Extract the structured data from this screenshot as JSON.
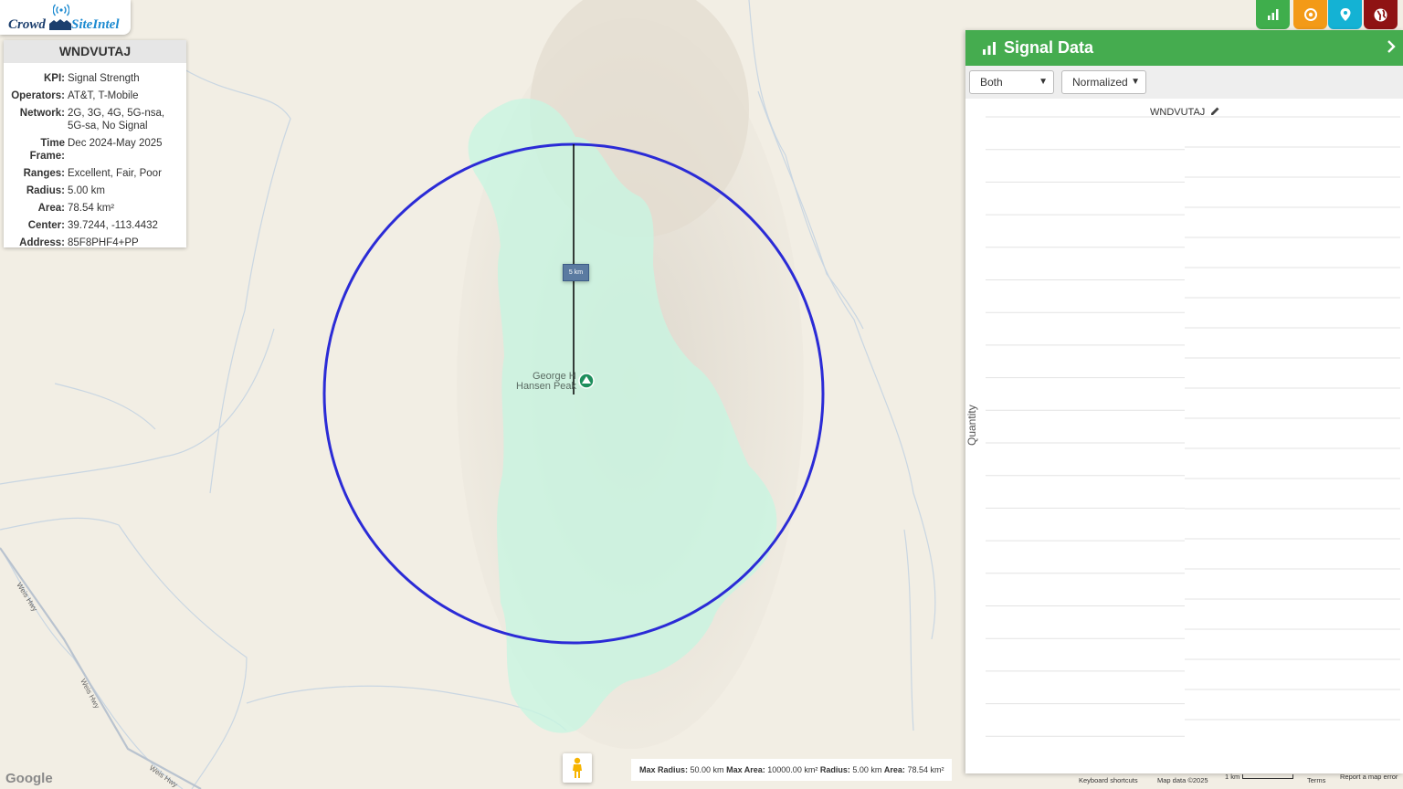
{
  "logo": {
    "word1": "Crowd",
    "word2": "SiteIntel"
  },
  "info": {
    "title": "WNDVUTAJ",
    "rows": [
      {
        "k": "KPI:",
        "v": "Signal Strength"
      },
      {
        "k": "Operators:",
        "v": "AT&T, T-Mobile"
      },
      {
        "k": "Network:",
        "v": "2G, 3G, 4G, 5G-nsa, 5G-sa, No Signal"
      },
      {
        "k": "Time Frame:",
        "v": "Dec 2024-May 2025"
      },
      {
        "k": "Ranges:",
        "v": "Excellent, Fair, Poor"
      },
      {
        "k": "Radius:",
        "v": "5.00 km"
      },
      {
        "k": "Area:",
        "v": "78.54 km²"
      },
      {
        "k": "Center:",
        "v": "39.7244, -113.4432"
      },
      {
        "k": "Address:",
        "v": "85F8PHF4+PP"
      }
    ]
  },
  "top_buttons": [
    "bar-chart-icon",
    "target-icon",
    "location-pin-icon",
    "globe-icon"
  ],
  "panel": {
    "title": "Signal Data",
    "mode_select": "Both",
    "scale_select": "Normalized",
    "chart_title": "WNDVUTAJ",
    "y_label": "Quantity"
  },
  "map": {
    "radius_label": "5 km",
    "peak_line1": "George H",
    "peak_line2": "Hansen Peak",
    "road_labels": [
      "Weis Hwy",
      "Weis Hwy",
      "Weis Hwy"
    ],
    "circle_color": "#2b2bd6",
    "coverage_color": "#c8f5e1"
  },
  "stats": {
    "max_radius_label": "Max Radius:",
    "max_radius": "50.00 km",
    "max_area_label": "Max Area:",
    "max_area": "10000.00 km²",
    "radius_label": "Radius:",
    "radius": "5.00 km",
    "area_label": "Area:",
    "area": "78.54 km²"
  },
  "footer": {
    "google": "Google",
    "keyboard": "Keyboard shortcuts",
    "mapdata": "Map data ©2025",
    "scale": "1 km",
    "terms": "Terms",
    "report": "Report a map error"
  }
}
